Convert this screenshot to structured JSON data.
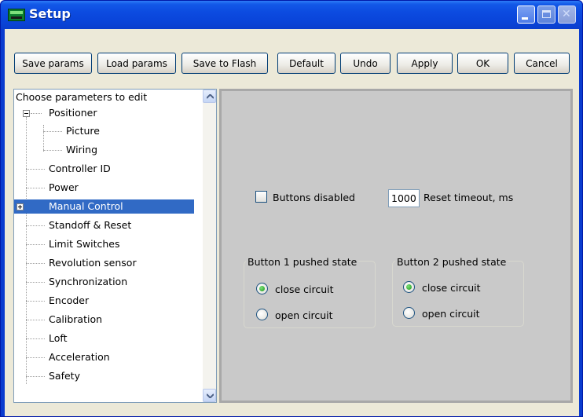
{
  "window": {
    "title": "Setup"
  },
  "toolbar": {
    "save_params": "Save params",
    "load_params": "Load params",
    "save_to_flash": "Save to Flash",
    "default": "Default",
    "undo": "Undo",
    "apply": "Apply",
    "ok": "OK",
    "cancel": "Cancel"
  },
  "tree": {
    "header": "Choose parameters to edit",
    "items": [
      {
        "label": "Positioner",
        "level": 0,
        "expander": "minus"
      },
      {
        "label": "Picture",
        "level": 1
      },
      {
        "label": "Wiring",
        "level": 1
      },
      {
        "label": "Controller ID",
        "level": 0
      },
      {
        "label": "Power",
        "level": 0
      },
      {
        "label": "Manual Control",
        "level": 0,
        "expander": "plus",
        "selected": true
      },
      {
        "label": "Standoff & Reset",
        "level": 0
      },
      {
        "label": "Limit Switches",
        "level": 0
      },
      {
        "label": "Revolution sensor",
        "level": 0
      },
      {
        "label": "Synchronization",
        "level": 0
      },
      {
        "label": "Encoder",
        "level": 0
      },
      {
        "label": "Calibration",
        "level": 0
      },
      {
        "label": "Loft",
        "level": 0
      },
      {
        "label": "Acceleration",
        "level": 0
      },
      {
        "label": "Safety",
        "level": 0
      }
    ]
  },
  "manual_control": {
    "buttons_disabled_label": "Buttons disabled",
    "buttons_disabled_checked": false,
    "reset_timeout_value": "1000",
    "reset_timeout_label": "Reset timeout, ms",
    "button1": {
      "title": "Button 1 pushed state",
      "option_close": "close circuit",
      "option_open": "open circuit",
      "selected": "close circuit"
    },
    "button2": {
      "title": "Button 2 pushed state",
      "option_close": "close circuit",
      "option_open": "open circuit",
      "selected": "close circuit"
    }
  },
  "colors": {
    "titlebar": "#0a45da",
    "selection": "#316ac5",
    "panel_bg": "#c9c9c9",
    "window_bg": "#ece9d8",
    "radio_dot": "#1b9a1b"
  },
  "icons": {
    "app": "app-icon",
    "minimize": "minimize-icon",
    "maximize": "maximize-icon",
    "close": "close-icon",
    "scroll_up": "scroll-up-icon",
    "scroll_down": "scroll-down-icon"
  }
}
